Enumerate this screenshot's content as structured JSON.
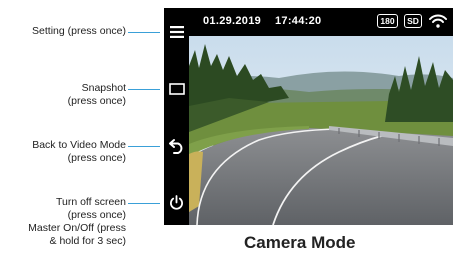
{
  "callouts": {
    "setting": "Setting (press once)",
    "snapshot": "Snapshot\n(press  once)",
    "back": "Back to Video Mode\n(press once)",
    "power": "Turn off screen\n(press once)\nMaster On/Off (press\n& hold for 3 sec)"
  },
  "status": {
    "date": "01.29.2019",
    "time": "17:44:20",
    "rotation_badge": "180",
    "storage_badge": "SD"
  },
  "icons": {
    "menu": "hamburger-icon",
    "snapshot": "rectangle-icon",
    "back": "back-arrow-icon",
    "power": "power-icon",
    "wifi": "wifi-icon"
  },
  "colors": {
    "leader": "#3aa0d8",
    "frame": "#000000"
  },
  "caption": "Camera Mode"
}
